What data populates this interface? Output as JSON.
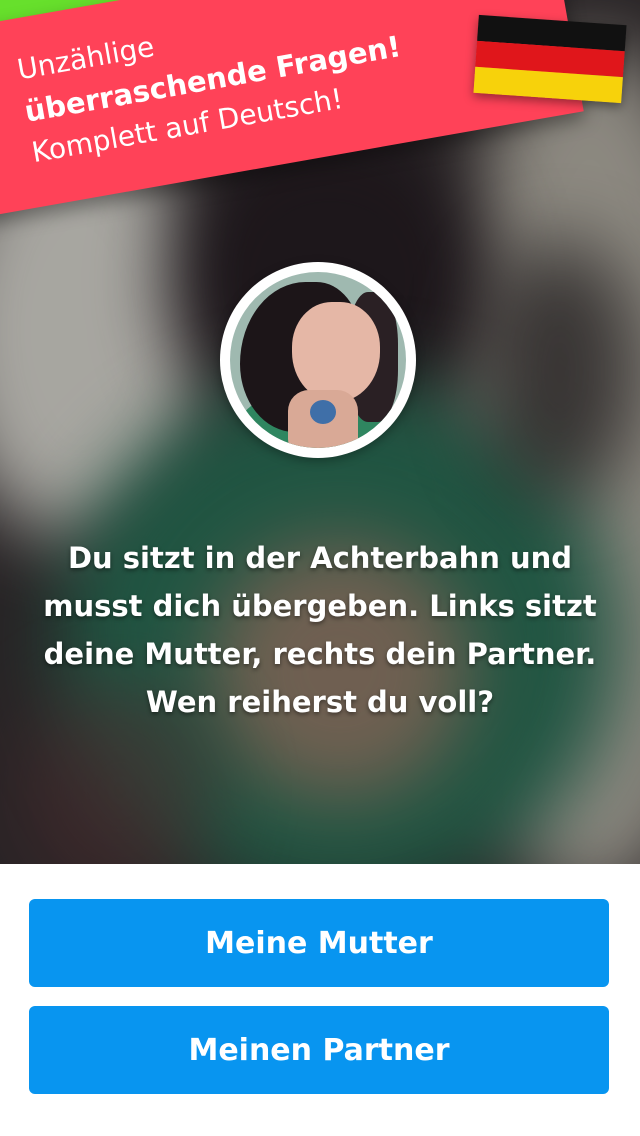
{
  "banner": {
    "line1": "Unzählige",
    "line2": "überraschende Fragen!",
    "line3": "Komplett auf Deutsch!",
    "flag_icon": "germany-flag-icon",
    "colors": {
      "red": "#ff4258",
      "green": "#67e02c"
    }
  },
  "question": {
    "text": "Du sitzt in der Achterbahn und musst dich übergeben. Links sitzt deine Mutter, rechts dein Partner. Wen reiherst du voll?"
  },
  "answers": [
    {
      "label": "Meine Mutter"
    },
    {
      "label": "Meinen Partner"
    }
  ],
  "colors": {
    "button": "#0895f0",
    "button_text": "#ffffff"
  }
}
